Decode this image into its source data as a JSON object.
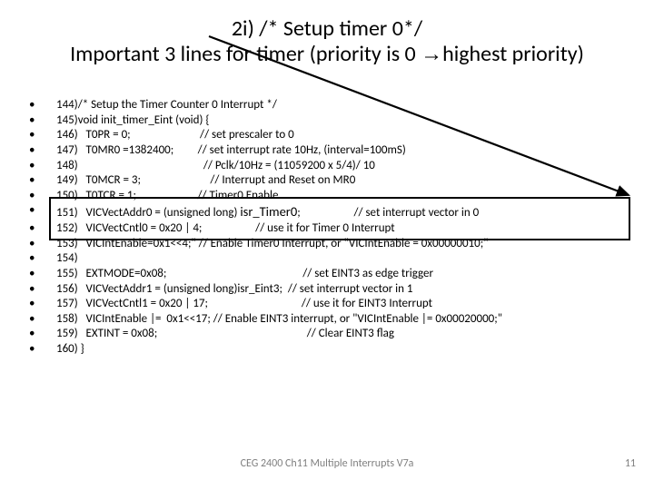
{
  "title": {
    "line1": "2i) /* Setup timer 0*/",
    "line2_pre": "Important 3 lines for timer (priority is 0 ",
    "line2_arrow": "→",
    "line2_post": "highest priority)"
  },
  "lines": [
    "144)/* Setup the Timer Counter 0 Interrupt */",
    "145)void init_timer_Eint (void) {",
    "146)   T0PR = 0;                          // set prescaler to 0",
    "147)   T0MR0 =1382400;         // set interrupt rate 10Hz, (interval=100mS)",
    "148)                                               // Pclk/10Hz = (11059200 x 5/4)/ 10",
    "149)   T0MCR = 3;                          // Interrupt and Reset on MR0",
    "150)   T0TCR = 1;                       // Timer0 Enable",
    "",
    "152)   VICVectCntl0 = 0x20 | 4;                    // use it for Timer 0 Interrupt",
    "153)   VICIntEnable=0x1<<4;\" // Enable Timer0 Interrupt, or \"VICIntEnable = 0x00000010;\"",
    "154)",
    "155)   EXTMODE=0x08;                                                   // set EINT3 as edge trigger",
    "156)   VICVectAddr1 = (unsigned long)isr_Eint3;  // set interrupt vector in 1",
    "157)   VICVectCntl1 = 0x20 | 17;                                   // use it for EINT3 Interrupt",
    "158)   VICIntEnable |=  0x1<<17; // Enable EINT3 interrupt, or \"VICIntEnable |= 0x00020000;\"",
    "159)   EXTINT = 0x08;                                                        // Clear EINT3 flag",
    "160) }"
  ],
  "line151": {
    "pre": "151)   VICVectAddr0 = (unsigned long) ",
    "isr": "isr_Timer0",
    "post": ";                    // set interrupt vector in 0"
  },
  "footer": {
    "center": "CEG 2400 Ch11 Multiple Interrupts V7a",
    "pageno": "11"
  }
}
